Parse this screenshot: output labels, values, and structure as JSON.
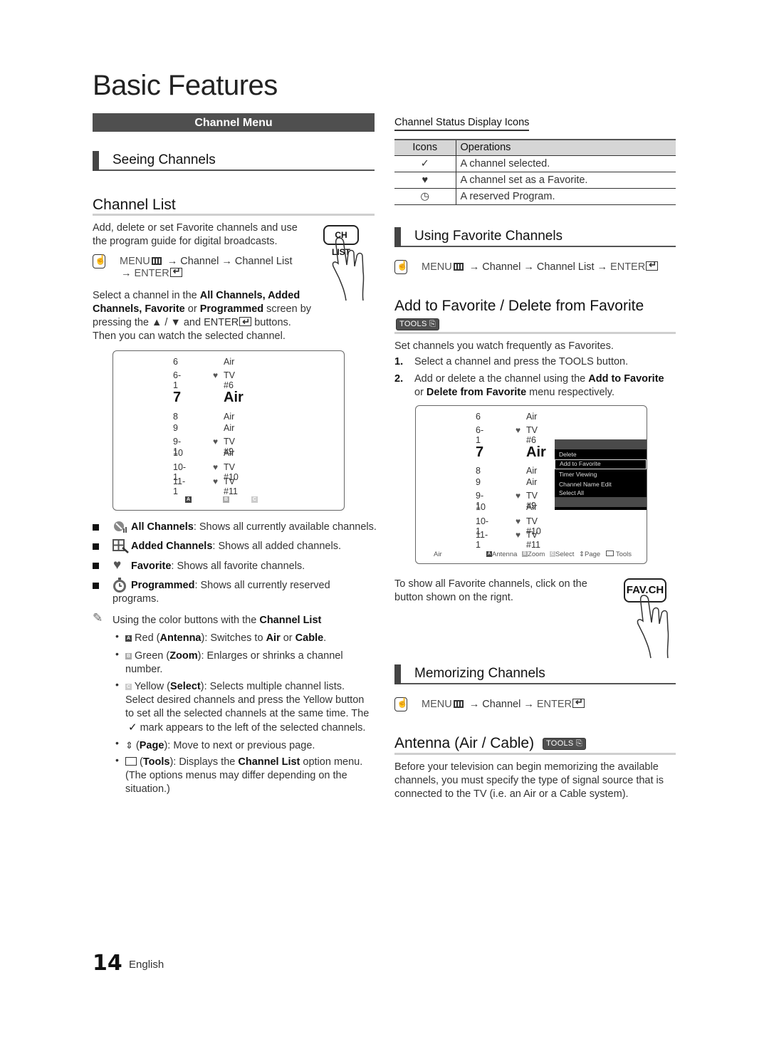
{
  "page_title": "Basic Features",
  "section_bar": "Channel Menu",
  "left": {
    "seeing_channels": "Seeing Channels",
    "channel_list_heading": "Channel List",
    "intro_line1": "Add, delete or set Favorite channels and use",
    "intro_line2": "the program guide for digital broadcasts.",
    "remote_button": "CH LIST",
    "menu_path": {
      "menu": "MENU",
      "arrow1": "→",
      "channel": "Channel",
      "arrow2": "→",
      "channel_list": "Channel List",
      "arrow3": "→",
      "enter": "ENTER"
    },
    "select_para": {
      "p1": "Select a channel in the ",
      "b1": "All Channels, Added",
      "b2": "Channels, Favorite",
      "p2": " or ",
      "b3": "Programmed",
      "p3": " screen by",
      "p4": "pressing the ▲ / ▼ and ",
      "enter": "ENTER",
      "p5": " buttons.",
      "p6": "Then you can watch the selected channel."
    },
    "tv_screen": {
      "rows": [
        {
          "num": "6",
          "fav": "",
          "name": "Air"
        },
        {
          "num": "6-1",
          "fav": "♥",
          "name": "TV #6"
        },
        {
          "num": "7",
          "fav": "",
          "name": "Air"
        },
        {
          "num": "8",
          "fav": "",
          "name": "Air"
        },
        {
          "num": "9",
          "fav": "",
          "name": "Air"
        },
        {
          "num": "9-1",
          "fav": "♥",
          "name": "TV #9"
        },
        {
          "num": "10",
          "fav": "",
          "name": "Air"
        },
        {
          "num": "10-1",
          "fav": "♥",
          "name": "TV #10"
        },
        {
          "num": "11-1",
          "fav": "♥",
          "name": "TV #11"
        }
      ],
      "keys": [
        "A",
        "B",
        "C"
      ]
    },
    "modes": [
      {
        "label": "All Channels",
        "desc": ": Shows all currently available channels."
      },
      {
        "label": "Added Channels",
        "desc": ": Shows all added channels."
      },
      {
        "label": "Favorite",
        "desc": ": Shows all favorite channels."
      },
      {
        "label": "Programmed",
        "desc": ": Shows all currently reserved"
      },
      {
        "label": "",
        "desc": "programs."
      }
    ],
    "note": {
      "text": "Using the color buttons with the ",
      "bold": "Channel List"
    },
    "color_buttons": {
      "red": {
        "key": "A",
        "p1": " Red (",
        "b1": "Antenna",
        "p2": "): Switches to ",
        "b2": "Air",
        "p3": " or ",
        "b3": "Cable",
        "p4": "."
      },
      "green": {
        "key": "B",
        "p1": " Green (",
        "b1": "Zoom",
        "p2": "): Enlarges or shrinks a channel",
        "p3": "number."
      },
      "yellow": {
        "key": "C",
        "p1": " Yellow (",
        "b1": "Select",
        "p2": "): Selects multiple channel lists.",
        "l2": "Select desired channels and press the Yellow button",
        "l3": "to set all the selected channels at the same time. The",
        "l4": " mark appears to the left of the selected channels."
      },
      "page": {
        "p1": " (",
        "b1": "Page",
        "p2": "): Move to next or previous page."
      },
      "tools": {
        "p1": " (",
        "b1": "Tools",
        "p2": "): Displays the ",
        "b2": "Channel List",
        "p3": " option menu.",
        "l2": "(The options menus may differ depending on the",
        "l3": "situation.)"
      }
    }
  },
  "right": {
    "status_icons_title": "Channel Status Display Icons",
    "table": {
      "headers": [
        "Icons",
        "Operations"
      ],
      "rows": [
        {
          "icon": "✓",
          "icon_name": "checkmark-icon",
          "text": "A channel selected."
        },
        {
          "icon": "♥",
          "icon_name": "heart-icon",
          "text": "A channel set as a Favorite."
        },
        {
          "icon": "◷",
          "icon_name": "clock-icon",
          "text": "A reserved Program."
        }
      ]
    },
    "using_favorite": "Using Favorite Channels",
    "menu_path": {
      "menu": "MENU",
      "arrow1": "→",
      "channel": "Channel",
      "arrow2": "→",
      "channel_list": "Channel List",
      "arrow3": "→",
      "enter": "ENTER"
    },
    "add_fav_heading": "Add to Favorite / Delete from Favorite",
    "tools_badge": "TOOLS",
    "set_channels": "Set channels you watch frequently as Favorites.",
    "steps": [
      {
        "n": "1.",
        "p1": "Select a channel and press the ",
        "b1": "TOOLS",
        "p2": " button."
      },
      {
        "n": "2.",
        "p1": "Add or delete a the channel using the ",
        "b1": "Add to Favorite",
        "l2a": "or ",
        "b2": "Delete from Favorite",
        "l2b": " menu respectively."
      }
    ],
    "tv_screen": {
      "rows": [
        {
          "num": "6",
          "fav": "",
          "name": "Air"
        },
        {
          "num": "6-1",
          "fav": "♥",
          "name": "TV #6"
        },
        {
          "num": "7",
          "fav": "",
          "name": "Air"
        },
        {
          "num": "8",
          "fav": "",
          "name": "Air"
        },
        {
          "num": "9",
          "fav": "",
          "name": "Air"
        },
        {
          "num": "9-1",
          "fav": "♥",
          "name": "TV #9"
        },
        {
          "num": "10",
          "fav": "",
          "name": "Air"
        },
        {
          "num": "10-1",
          "fav": "♥",
          "name": "TV #10"
        },
        {
          "num": "11-1",
          "fav": "♥",
          "name": "TV #11"
        }
      ],
      "tools_menu": [
        "Delete",
        "Add to Favorite",
        "Timer Viewing",
        "Channel Name Edit",
        "Select All"
      ],
      "selected_index": 1,
      "footer": {
        "source": "Air",
        "antenna": "Antenna",
        "zoom": "Zoom",
        "select": "Select",
        "page": "Page",
        "tools": "Tools"
      }
    },
    "fav_ch_line1": "To show all Favorite channels, click on the",
    "fav_ch_line2": "button shown on the rignt.",
    "fav_ch_button": "FAV.CH",
    "memorizing": "Memorizing Channels",
    "mem_menu_path": {
      "menu": "MENU",
      "arrow1": "→",
      "channel": "Channel",
      "arrow2": "→",
      "enter": "ENTER"
    },
    "antenna_heading": "Antenna (Air / Cable)",
    "antenna_para": [
      "Before your television can begin memorizing the available",
      "channels, you must specify the type of signal source that is",
      "connected to the TV (i.e. an Air or a Cable system)."
    ]
  },
  "footer": {
    "page_number": "14",
    "language": "English"
  }
}
